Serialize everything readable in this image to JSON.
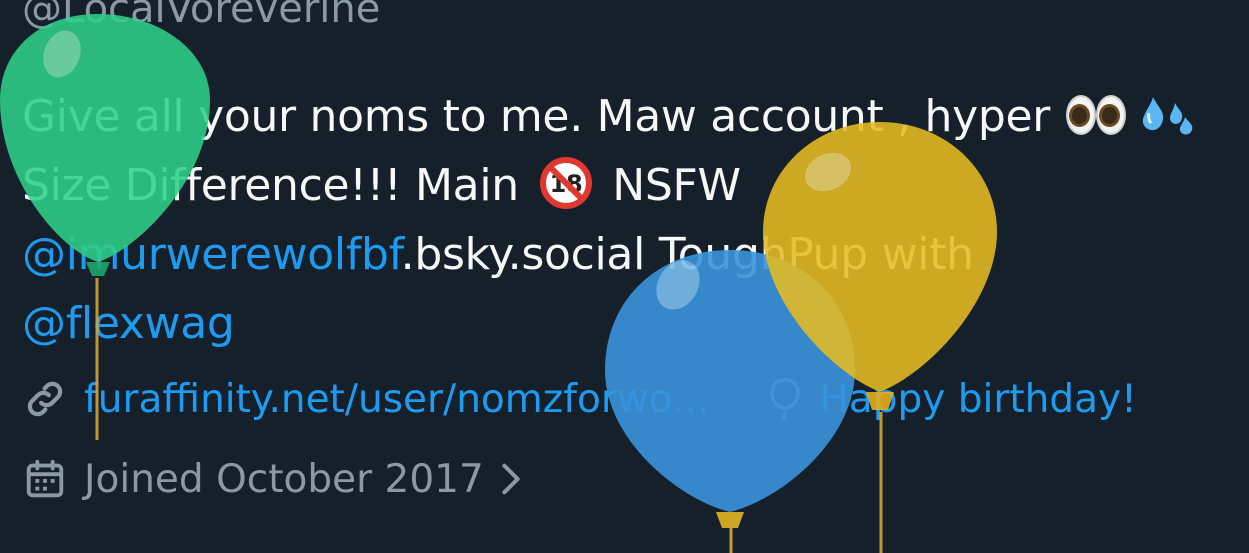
{
  "profile": {
    "handle": "@LocalVoreverine",
    "bio": {
      "line1_text": "Give all your noms to me. Maw account , hyper",
      "line2_text": "Size Difference!!! Main",
      "line2_tail": "NSFW",
      "line3_mention": "@imurwerewolfbf",
      "line3_text": ".bsky.social ToughPup with",
      "line4_mention": "@flexwag"
    },
    "website": "furaffinity.net/user/nomzforwo...",
    "birthday": "Happy birthday!",
    "joined": "Joined October 2017"
  },
  "icons": {
    "link": "link-icon",
    "balloon": "balloon-outline-icon",
    "calendar": "calendar-icon",
    "chevron": "chevron-right-icon",
    "eyes": "eyes-emoji-icon",
    "drops": "sweat-droplets-emoji-icon",
    "no_under_18": "no-one-under-eighteen-emoji-icon"
  },
  "colors": {
    "background": "#15202b",
    "text": "#f7f9f9",
    "secondary": "#8b98a5",
    "link": "#1d9bf0",
    "balloon_green": "#2fcf8a",
    "balloon_blue": "#3a94dc",
    "balloon_yellow": "#e6bb22"
  }
}
